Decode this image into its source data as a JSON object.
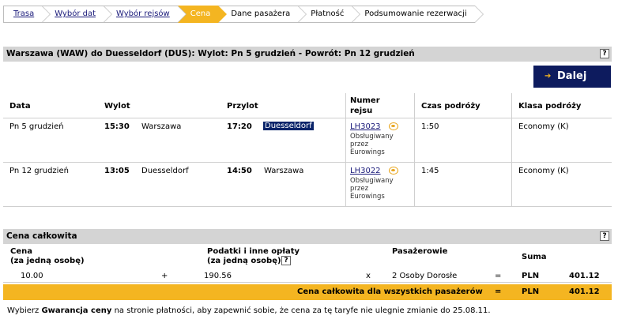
{
  "breadcrumb": [
    {
      "label": "Trasa",
      "state": "link"
    },
    {
      "label": "Wybór dat",
      "state": "link"
    },
    {
      "label": "Wybór rejsów",
      "state": "link"
    },
    {
      "label": "Cena",
      "state": "active"
    },
    {
      "label": "Dane pasażera",
      "state": "pending"
    },
    {
      "label": "Płatność",
      "state": "pending"
    },
    {
      "label": "Podsumowanie rezerwacji",
      "state": "pending"
    }
  ],
  "route_header": "Warszawa (WAW) do Duesseldorf (DUS): Wylot: Pn 5 grudzień - Powrót: Pn 12 grudzień",
  "help_glyph": "?",
  "next_button": {
    "label": "Dalej",
    "arrow": "➔"
  },
  "flights": {
    "headers": {
      "date": "Data",
      "departure": "Wylot",
      "arrival": "Przylot",
      "flight_no_1": "Numer",
      "flight_no_2": "rejsu",
      "duration": "Czas podróży",
      "class": "Klasa podróży"
    },
    "rows": [
      {
        "date": "Pn 5 grudzień",
        "dep_time": "15:30",
        "dep_city": "Warszawa",
        "arr_time": "17:20",
        "arr_city": "Duesseldorf",
        "flight": "LH3023",
        "op1": "Obsługiwany",
        "op2": "przez",
        "op3": "Eurowings",
        "duration": "1:50",
        "class": "Economy (K)"
      },
      {
        "date": "Pn 12 grudzień",
        "dep_time": "13:05",
        "dep_city": "Duesseldorf",
        "arr_time": "14:50",
        "arr_city": "Warszawa",
        "flight": "LH3022",
        "op1": "Obsługiwany",
        "op2": "przez",
        "op3": "Eurowings",
        "duration": "1:45",
        "class": "Economy (K)"
      }
    ]
  },
  "price": {
    "header": "Cena całkowita",
    "col_price_1": "Cena",
    "col_price_2": "(za jedną osobę)",
    "col_taxes_1": "Podatki i inne opłaty",
    "col_taxes_2": "(za jedną osobę)",
    "col_pax": "Pasażerowie",
    "col_sum": "Suma",
    "fare": "10.00",
    "plus": "+",
    "taxes": "190.56",
    "times": "x",
    "pax": "2 Osoby Dorosłe",
    "equals": "=",
    "currency": "PLN",
    "sum": "401.12",
    "total_label": "Cena całkowita dla wszystkich pasażerów",
    "total_equals": "=",
    "total_currency": "PLN",
    "total_sum": "401.12"
  },
  "footer": {
    "part1": "Wybierz ",
    "bold": "Gwarancja ceny",
    "part2": " na stronie płatności, aby zapewnić sobie, że cena za tę taryfe nie ulegnie zmianie do 25.08.11."
  }
}
